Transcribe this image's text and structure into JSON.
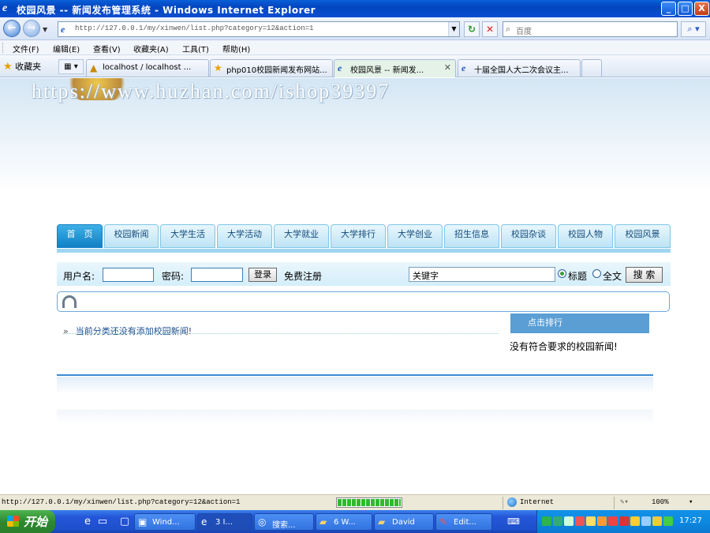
{
  "window": {
    "title": "校园风景 -- 新闻发布管理系统 - Windows Internet Explorer",
    "controls": {
      "minimize": "_",
      "maximize": "□",
      "close": "X"
    }
  },
  "address": {
    "url": "http://127.0.0.1/my/xinwen/list.php?category=12&action=1",
    "search_placeholder": "百度"
  },
  "menu": [
    "文件(F)",
    "编辑(E)",
    "查看(V)",
    "收藏夹(A)",
    "工具(T)",
    "帮助(H)"
  ],
  "favorites": {
    "label": "收藏夹"
  },
  "tabs": [
    {
      "label": "localhost / localhost ...",
      "icon": "phpmyadmin-icon"
    },
    {
      "label": "php010校园新闻发布网站...",
      "icon": "star-icon"
    },
    {
      "label": "校园风景 -- 新闻发...",
      "icon": "ie-icon",
      "active": true
    },
    {
      "label": "十届全国人大二次会议主...",
      "icon": "ie-icon"
    }
  ],
  "page": {
    "watermark": "https://www.huzhan.com/ishop39397",
    "nav": [
      "首　页",
      "校园新闻",
      "大学生活",
      "大学活动",
      "大学就业",
      "大学排行",
      "大学创业",
      "招生信息",
      "校园杂谈",
      "校园人物",
      "校园风景"
    ],
    "login": {
      "username_label": "用户名:",
      "password_label": "密码:",
      "login_button": "登录",
      "register_link": "免费注册",
      "keyword_value": "关键字",
      "radio_title": "标题",
      "radio_fulltext": "全文",
      "search_button": "搜 索"
    },
    "list_empty": "当前分类还没有添加校园新闻!",
    "rank_title": "点击排行",
    "rank_empty": "没有符合要求的校园新闻!"
  },
  "status": {
    "url": "http://127.0.0.1/my/xinwen/list.php?category=12&action=1",
    "zone": "Internet",
    "zoom": "100%"
  },
  "taskbar": {
    "start": "开始",
    "items": [
      {
        "label": "Wind...",
        "icon": "window-icon"
      },
      {
        "label": "3 I...",
        "icon": "ie-icon",
        "active": true
      },
      {
        "label": "搜索...",
        "icon": "search-icon"
      },
      {
        "label": "6 W...",
        "icon": "folder-icon"
      },
      {
        "label": "David",
        "icon": "folder-icon"
      },
      {
        "label": "Edit...",
        "icon": "editor-icon"
      }
    ],
    "clock": "17:27"
  }
}
